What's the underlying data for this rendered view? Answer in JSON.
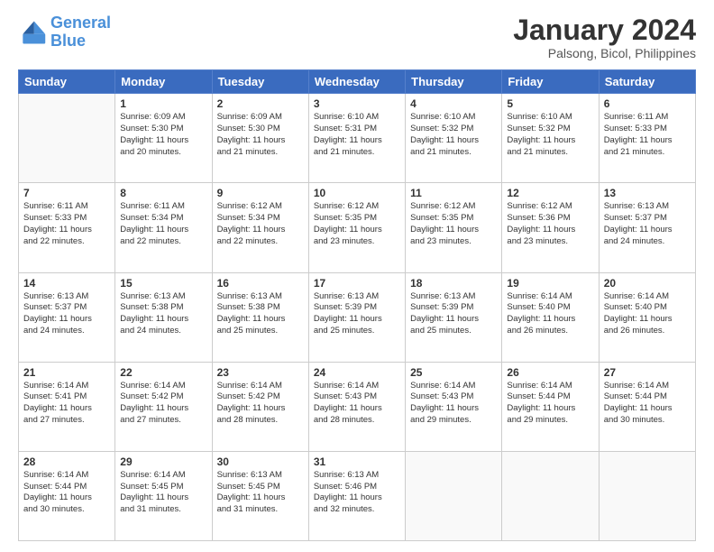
{
  "header": {
    "logo_line1": "General",
    "logo_line2": "Blue",
    "title": "January 2024",
    "subtitle": "Palsong, Bicol, Philippines"
  },
  "calendar": {
    "headers": [
      "Sunday",
      "Monday",
      "Tuesday",
      "Wednesday",
      "Thursday",
      "Friday",
      "Saturday"
    ],
    "weeks": [
      [
        {
          "day": "",
          "info": ""
        },
        {
          "day": "1",
          "info": "Sunrise: 6:09 AM\nSunset: 5:30 PM\nDaylight: 11 hours\nand 20 minutes."
        },
        {
          "day": "2",
          "info": "Sunrise: 6:09 AM\nSunset: 5:30 PM\nDaylight: 11 hours\nand 21 minutes."
        },
        {
          "day": "3",
          "info": "Sunrise: 6:10 AM\nSunset: 5:31 PM\nDaylight: 11 hours\nand 21 minutes."
        },
        {
          "day": "4",
          "info": "Sunrise: 6:10 AM\nSunset: 5:32 PM\nDaylight: 11 hours\nand 21 minutes."
        },
        {
          "day": "5",
          "info": "Sunrise: 6:10 AM\nSunset: 5:32 PM\nDaylight: 11 hours\nand 21 minutes."
        },
        {
          "day": "6",
          "info": "Sunrise: 6:11 AM\nSunset: 5:33 PM\nDaylight: 11 hours\nand 21 minutes."
        }
      ],
      [
        {
          "day": "7",
          "info": "Sunrise: 6:11 AM\nSunset: 5:33 PM\nDaylight: 11 hours\nand 22 minutes."
        },
        {
          "day": "8",
          "info": "Sunrise: 6:11 AM\nSunset: 5:34 PM\nDaylight: 11 hours\nand 22 minutes."
        },
        {
          "day": "9",
          "info": "Sunrise: 6:12 AM\nSunset: 5:34 PM\nDaylight: 11 hours\nand 22 minutes."
        },
        {
          "day": "10",
          "info": "Sunrise: 6:12 AM\nSunset: 5:35 PM\nDaylight: 11 hours\nand 23 minutes."
        },
        {
          "day": "11",
          "info": "Sunrise: 6:12 AM\nSunset: 5:35 PM\nDaylight: 11 hours\nand 23 minutes."
        },
        {
          "day": "12",
          "info": "Sunrise: 6:12 AM\nSunset: 5:36 PM\nDaylight: 11 hours\nand 23 minutes."
        },
        {
          "day": "13",
          "info": "Sunrise: 6:13 AM\nSunset: 5:37 PM\nDaylight: 11 hours\nand 24 minutes."
        }
      ],
      [
        {
          "day": "14",
          "info": "Sunrise: 6:13 AM\nSunset: 5:37 PM\nDaylight: 11 hours\nand 24 minutes."
        },
        {
          "day": "15",
          "info": "Sunrise: 6:13 AM\nSunset: 5:38 PM\nDaylight: 11 hours\nand 24 minutes."
        },
        {
          "day": "16",
          "info": "Sunrise: 6:13 AM\nSunset: 5:38 PM\nDaylight: 11 hours\nand 25 minutes."
        },
        {
          "day": "17",
          "info": "Sunrise: 6:13 AM\nSunset: 5:39 PM\nDaylight: 11 hours\nand 25 minutes."
        },
        {
          "day": "18",
          "info": "Sunrise: 6:13 AM\nSunset: 5:39 PM\nDaylight: 11 hours\nand 25 minutes."
        },
        {
          "day": "19",
          "info": "Sunrise: 6:14 AM\nSunset: 5:40 PM\nDaylight: 11 hours\nand 26 minutes."
        },
        {
          "day": "20",
          "info": "Sunrise: 6:14 AM\nSunset: 5:40 PM\nDaylight: 11 hours\nand 26 minutes."
        }
      ],
      [
        {
          "day": "21",
          "info": "Sunrise: 6:14 AM\nSunset: 5:41 PM\nDaylight: 11 hours\nand 27 minutes."
        },
        {
          "day": "22",
          "info": "Sunrise: 6:14 AM\nSunset: 5:42 PM\nDaylight: 11 hours\nand 27 minutes."
        },
        {
          "day": "23",
          "info": "Sunrise: 6:14 AM\nSunset: 5:42 PM\nDaylight: 11 hours\nand 28 minutes."
        },
        {
          "day": "24",
          "info": "Sunrise: 6:14 AM\nSunset: 5:43 PM\nDaylight: 11 hours\nand 28 minutes."
        },
        {
          "day": "25",
          "info": "Sunrise: 6:14 AM\nSunset: 5:43 PM\nDaylight: 11 hours\nand 29 minutes."
        },
        {
          "day": "26",
          "info": "Sunrise: 6:14 AM\nSunset: 5:44 PM\nDaylight: 11 hours\nand 29 minutes."
        },
        {
          "day": "27",
          "info": "Sunrise: 6:14 AM\nSunset: 5:44 PM\nDaylight: 11 hours\nand 30 minutes."
        }
      ],
      [
        {
          "day": "28",
          "info": "Sunrise: 6:14 AM\nSunset: 5:44 PM\nDaylight: 11 hours\nand 30 minutes."
        },
        {
          "day": "29",
          "info": "Sunrise: 6:14 AM\nSunset: 5:45 PM\nDaylight: 11 hours\nand 31 minutes."
        },
        {
          "day": "30",
          "info": "Sunrise: 6:13 AM\nSunset: 5:45 PM\nDaylight: 11 hours\nand 31 minutes."
        },
        {
          "day": "31",
          "info": "Sunrise: 6:13 AM\nSunset: 5:46 PM\nDaylight: 11 hours\nand 32 minutes."
        },
        {
          "day": "",
          "info": ""
        },
        {
          "day": "",
          "info": ""
        },
        {
          "day": "",
          "info": ""
        }
      ]
    ]
  }
}
